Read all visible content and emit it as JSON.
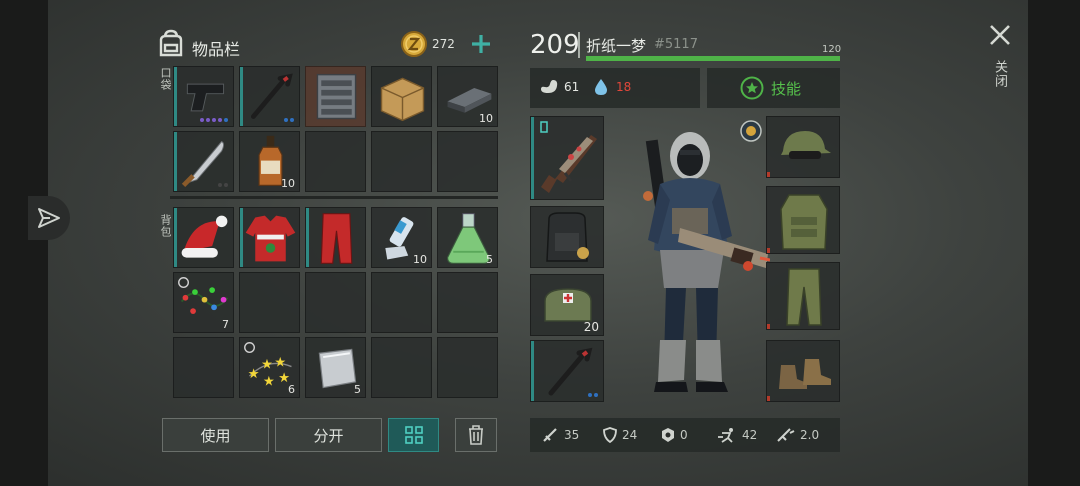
{
  "inventory": {
    "title": "物品栏",
    "coins": "272",
    "pockets_label": "口袋",
    "backpack_label": "背包",
    "pockets": [
      {
        "item": "pistol-icon",
        "count": "",
        "dots": [
          "#7a5cc7",
          "#7a5cc7",
          "#7a5cc7",
          "#7a5cc7",
          "#2f70c0"
        ]
      },
      {
        "item": "crowbar-icon",
        "count": "",
        "dots": [
          "#2f70c0",
          "#2f70c0"
        ]
      },
      {
        "item": "tool-cabinet-icon",
        "count": "",
        "dots": []
      },
      {
        "item": "cardboard-box-icon",
        "count": "",
        "dots": []
      },
      {
        "item": "metal-bar-icon",
        "count": "10",
        "dots": []
      },
      {
        "item": "machete-icon",
        "count": "",
        "dots": [
          "#444",
          "#444"
        ]
      },
      {
        "item": "whiskey-bottle-icon",
        "count": "10",
        "dots": []
      }
    ],
    "backpack": [
      {
        "item": "santa-hat-icon",
        "count": ""
      },
      {
        "item": "christmas-sweater-icon",
        "count": ""
      },
      {
        "item": "red-pants-icon",
        "count": ""
      },
      {
        "item": "inhaler-icon",
        "count": "10"
      },
      {
        "item": "flask-icon",
        "count": "5"
      },
      {
        "item": "string-lights-icon",
        "count": "7"
      },
      {
        "item": "star-garland-icon",
        "count": "6"
      },
      {
        "item": "metal-sheet-icon",
        "count": "5"
      }
    ],
    "use_label": "使用",
    "split_label": "分开"
  },
  "character": {
    "level": "209",
    "name": "折纸一梦",
    "tag": "#5117",
    "xp_label": "120",
    "xp_fraction": 1.0,
    "food": "61",
    "water": "18",
    "skills_label": "技能",
    "close_label": "关闭",
    "stats": [
      {
        "icon": "sword-icon",
        "value": "35"
      },
      {
        "icon": "shield-icon",
        "value": "24"
      },
      {
        "icon": "hazard-icon",
        "value": "0"
      },
      {
        "icon": "running-icon",
        "value": "42"
      },
      {
        "icon": "speed-icon",
        "value": "2.0"
      }
    ]
  },
  "colors": {
    "accent": "#4fb348",
    "teal": "#2f8a84",
    "water_red": "#e0473a"
  }
}
